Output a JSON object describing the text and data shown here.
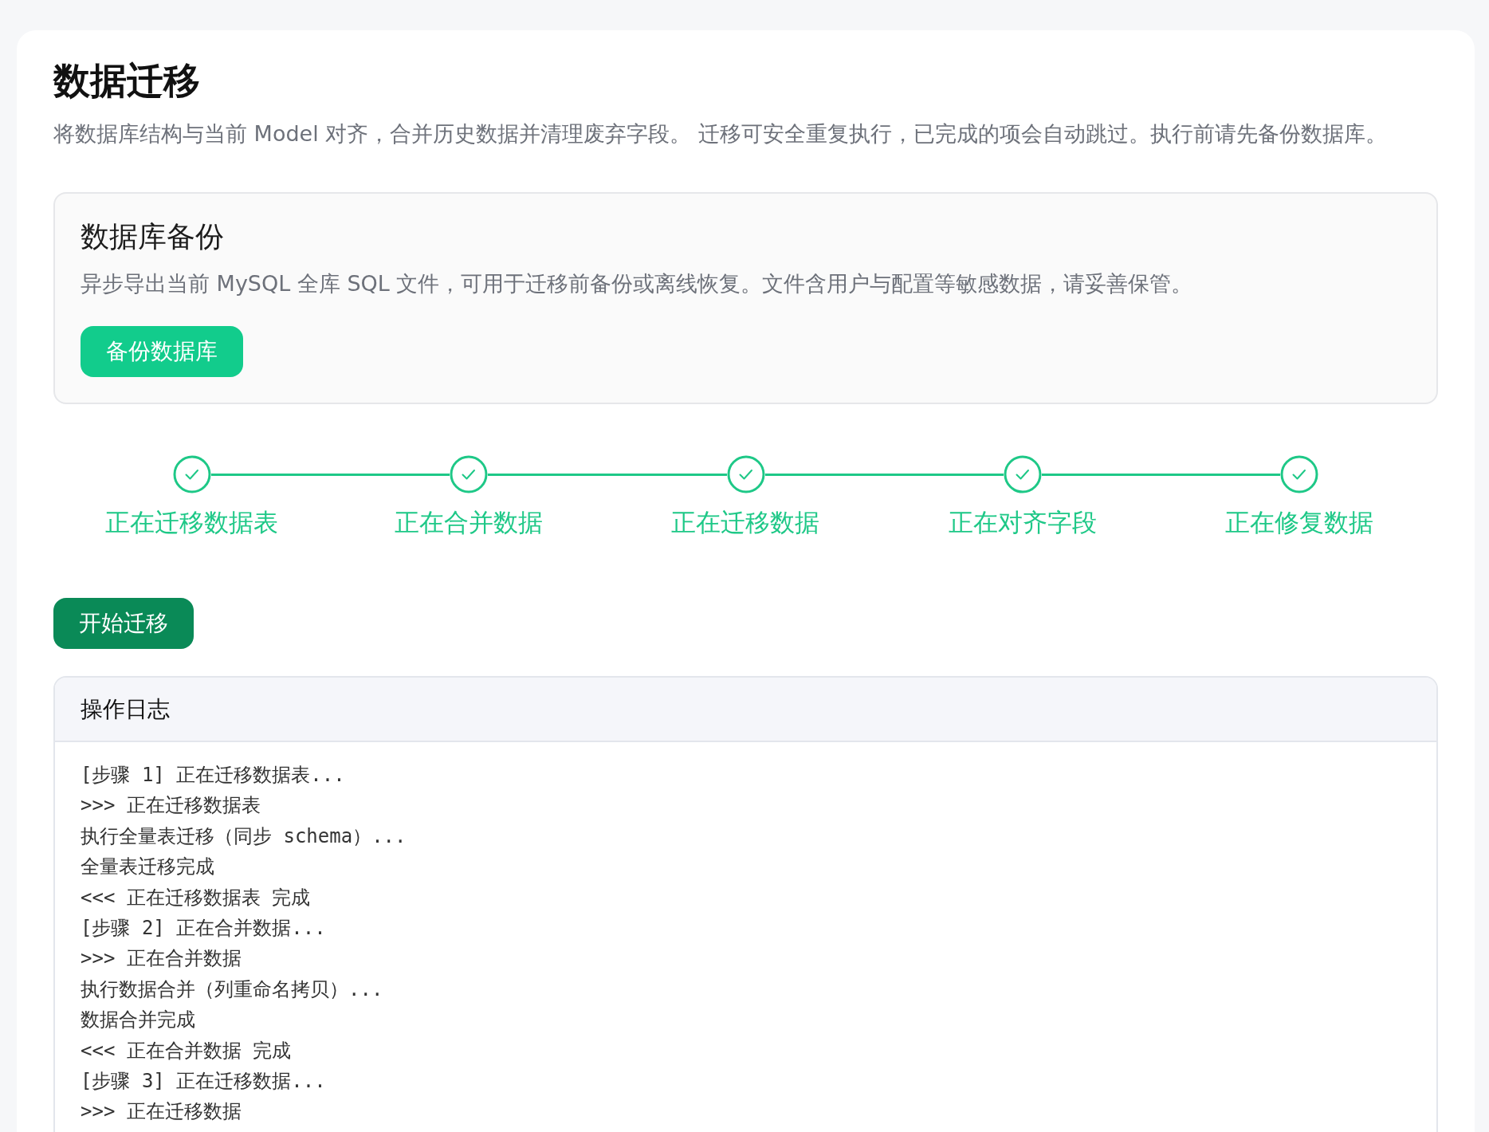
{
  "page": {
    "title": "数据迁移",
    "description": "将数据库结构与当前 Model 对齐，合并历史数据并清理废弃字段。 迁移可安全重复执行，已完成的项会自动跳过。执行前请先备份数据库。"
  },
  "backup_card": {
    "title": "数据库备份",
    "description": "异步导出当前 MySQL 全库 SQL 文件，可用于迁移前备份或离线恢复。文件含用户与配置等敏感数据，请妥善保管。",
    "button": "备份数据库"
  },
  "steps": [
    {
      "label": "正在迁移数据表",
      "completed": true
    },
    {
      "label": "正在合并数据",
      "completed": true
    },
    {
      "label": "正在迁移数据",
      "completed": true
    },
    {
      "label": "正在对齐字段",
      "completed": true
    },
    {
      "label": "正在修复数据",
      "completed": true
    }
  ],
  "start_button": "开始迁移",
  "log": {
    "title": "操作日志",
    "lines": [
      "[步骤 1] 正在迁移数据表...",
      ">>> 正在迁移数据表",
      "执行全量表迁移（同步 schema）...",
      "全量表迁移完成",
      "<<< 正在迁移数据表 完成",
      "[步骤 2] 正在合并数据...",
      ">>> 正在合并数据",
      "执行数据合并（列重命名拷贝）...",
      "数据合并完成",
      "<<< 正在合并数据 完成",
      "[步骤 3] 正在迁移数据...",
      ">>> 正在迁移数据"
    ]
  }
}
